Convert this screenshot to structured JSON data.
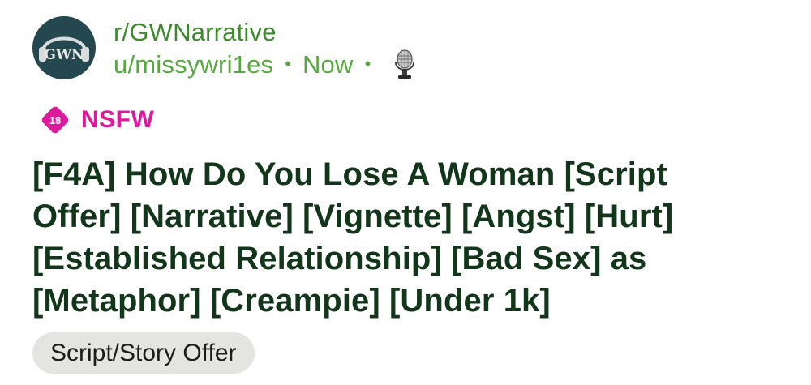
{
  "post": {
    "subreddit": "r/GWNarrative",
    "username": "u/missywri1es",
    "separator": "•",
    "time": "Now",
    "avatar_text": "GWN",
    "nsfw_badge_number": "18",
    "nsfw_label": "NSFW",
    "title": "[F4A] How Do You Lose A Woman [Script Offer] [Narrative] [Vignette] [Angst] [Hurt] [Established Relationship] [Bad Sex] as [Metaphor] [Creampie] [Under 1k]",
    "flair": "Script/Story Offer"
  },
  "icons": {
    "avatar": "headphones-logo-icon",
    "user_flair": "microphone-icon",
    "nsfw": "nsfw-diamond-icon"
  },
  "colors": {
    "subreddit": "#3e8b2e",
    "meta": "#56a83f",
    "nsfw": "#dc1a9b",
    "title": "#123619",
    "avatar_bg": "#25474f",
    "flair_bg": "#e4e4e2"
  }
}
